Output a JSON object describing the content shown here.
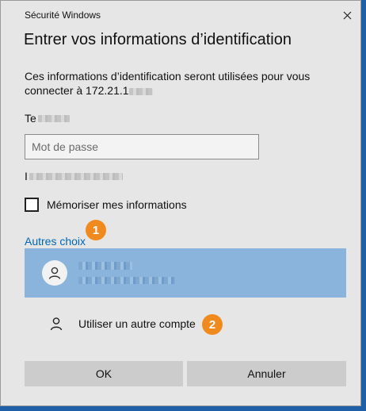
{
  "window": {
    "title": "Sécurité Windows"
  },
  "heading": "Entrer vos informations d’identification",
  "description": "Ces informations d’identification seront utilisées pour vous connecter à 172.21.1",
  "username_prefix": "Te",
  "password": {
    "placeholder": "Mot de passe",
    "value": ""
  },
  "domain_prefix": "I",
  "remember": {
    "label": "Mémoriser mes informations",
    "checked": false
  },
  "more_choices": {
    "label": "Autres choix"
  },
  "other_account": {
    "label": "Utiliser un autre compte"
  },
  "buttons": {
    "ok": "OK",
    "cancel": "Annuler"
  },
  "annotations": [
    "1",
    "2"
  ],
  "colors": {
    "dialog_bg": "#e6e6e6",
    "selected_bg": "#8ab4dc",
    "link": "#0066b4",
    "badge": "#f08a1e",
    "button_bg": "#cccccc",
    "desktop": "#1e5fa8"
  },
  "icons": {
    "close": "close-icon",
    "avatar": "user-icon",
    "other": "user-outline-icon"
  }
}
